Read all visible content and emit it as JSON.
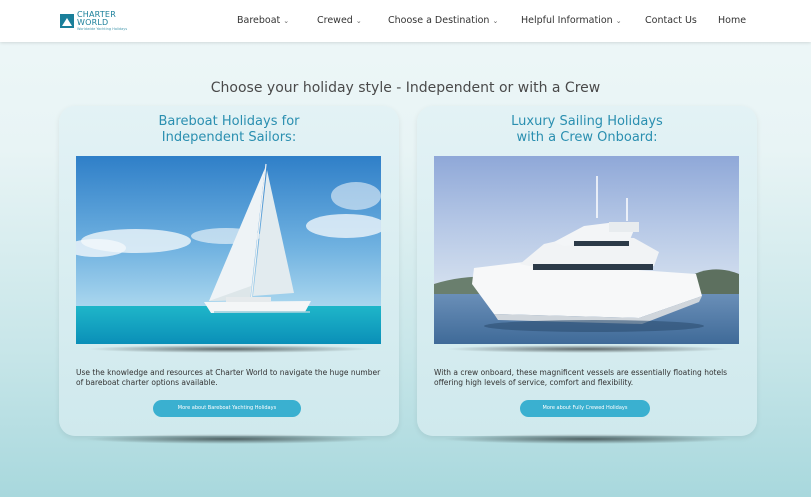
{
  "header": {
    "logo": {
      "title": "CHARTER WORLD",
      "subtitle": "Worldwide Yachting Holidays"
    },
    "nav": [
      {
        "label": "Bareboat",
        "chevron": "⌄"
      },
      {
        "label": "Crewed",
        "chevron": "⌄"
      },
      {
        "label": "Choose a Destination",
        "chevron": "⌄"
      },
      {
        "label": "Helpful Information",
        "chevron": "⌄"
      },
      {
        "label": "Contact Us",
        "chevron": ""
      },
      {
        "label": "Home",
        "chevron": ""
      }
    ]
  },
  "main": {
    "headline": "Choose your holiday style - Independent or with a Crew",
    "cards": [
      {
        "title_line1": "Bareboat Holidays for",
        "title_line2": "Independent Sailors:",
        "image_alt": "Sailing catamaran on turquoise sea",
        "text": "Use the knowledge and resources at Charter World to navigate the huge number of bareboat charter options available.",
        "button": "More about Bareboat Yachting Holidays"
      },
      {
        "title_line1": "Luxury Sailing Holidays",
        "title_line2": "with a Crew Onboard:",
        "image_alt": "White luxury motor yacht at anchor",
        "text": "With a crew onboard, these magnificent vessels are essentially floating hotels offering high levels of service, comfort and flexibility.",
        "button": "More about Fully Crewed Holidays"
      }
    ]
  },
  "colors": {
    "accent": "#2a8fb0",
    "button": "#3ab0d0",
    "logo": "#1a7f9a"
  }
}
